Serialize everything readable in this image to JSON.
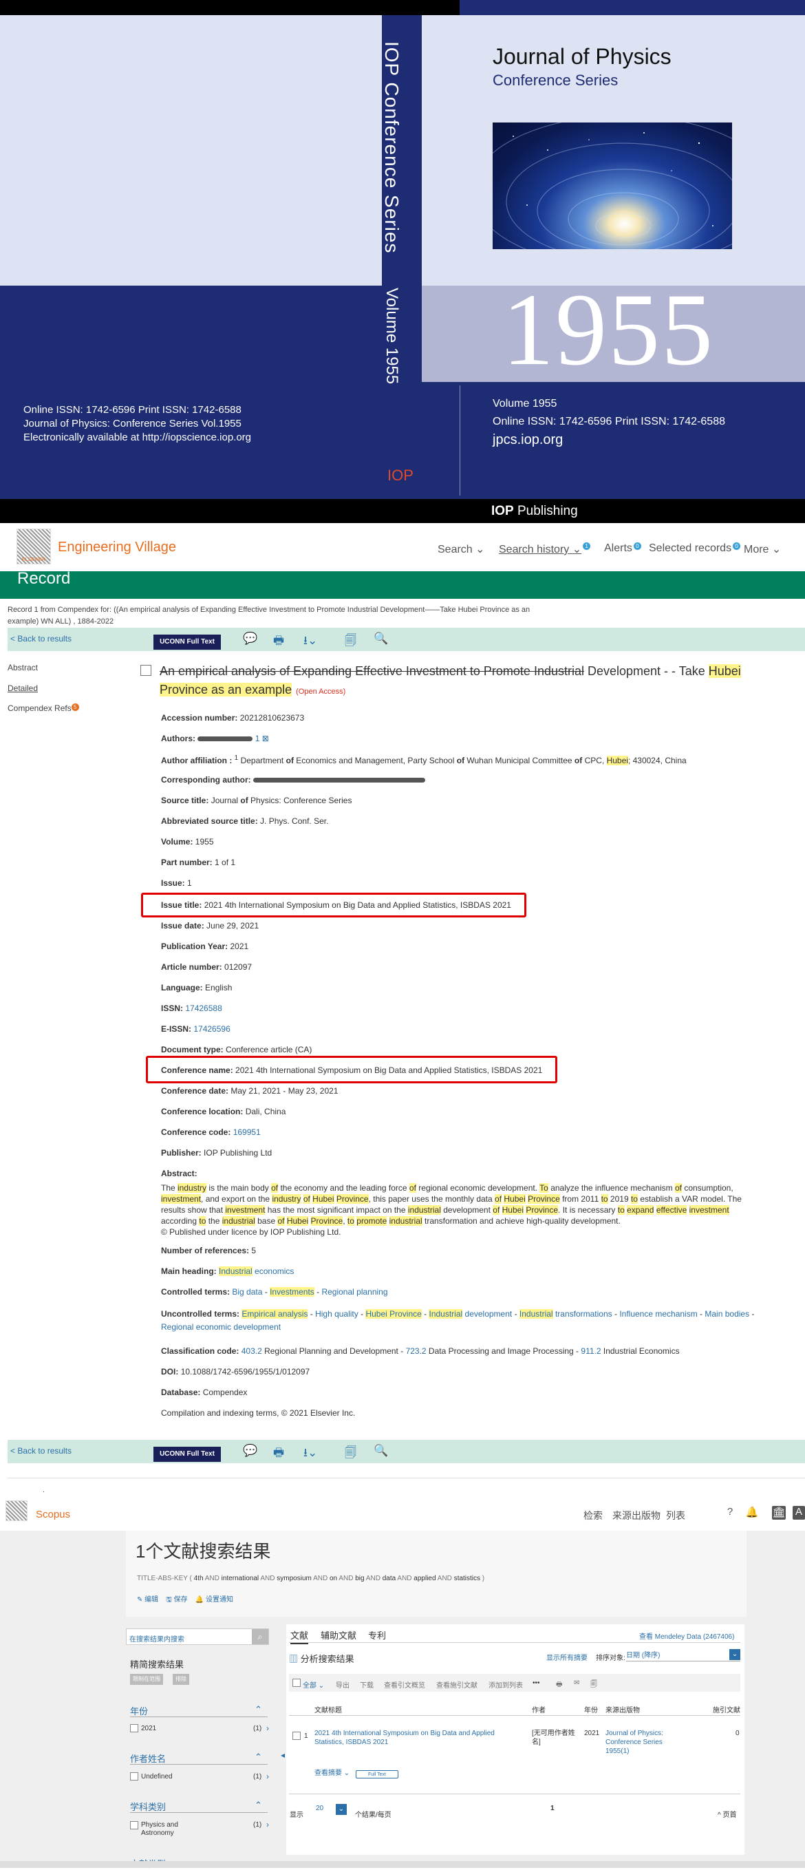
{
  "cover": {
    "spine_title": "IOP Conference Series",
    "spine_volume": "Volume 1955",
    "journal_title": "Journal of Physics",
    "journal_subtitle": "Conference Series",
    "big_number": "1955",
    "right_volume": "Volume 1955",
    "right_issn": "Online ISSN: 1742-6596   Print ISSN: 1742-6588",
    "right_url": "jpcs.iop.org",
    "left_issn": "Online ISSN: 1742-6596   Print ISSN: 1742-6588",
    "left_series": "Journal of Physics: Conference Series  Vol.1955",
    "left_avail": "Electronically available at http://iopscience.iop.org",
    "spine_logo": "IOP",
    "publisher_bold": "IOP",
    "publisher_rest": " Publishing"
  },
  "ev": {
    "logo_text": "ELSEVIER",
    "brand": "Engineering Village",
    "nav": [
      {
        "label": "Search",
        "caret": "⌄"
      },
      {
        "label": "Search history",
        "caret": "⌄",
        "badge": "1"
      },
      {
        "label": "Alerts",
        "badge": "0"
      },
      {
        "label": "Selected records",
        "badge": "0"
      },
      {
        "label": "More",
        "caret": "⌄"
      }
    ],
    "record_heading": "Record",
    "crumb": "Record 1 from Compendex for: ((An empirical analysis of Expanding Effective Investment to Promote Industrial Development——Take Hubei Province as an example) WN ALL) , 1884-2022",
    "back": "< Back to results",
    "uconn": "UCONN Full Text",
    "toolbar_icons": [
      "💬",
      "🖶",
      "⭳⌄",
      "🗐",
      "🔍"
    ],
    "side": [
      {
        "label": "Abstract"
      },
      {
        "label": "Detailed"
      },
      {
        "label": "Compendex Refs",
        "badge": "5"
      }
    ],
    "title_strike": "An empirical analysis of Expanding Effective Investment to Promote Industrial",
    "title_plain": " Development - - Take ",
    "title_hl1": "Hubei",
    "title_hl2": "Province as an example",
    "open_access": "(Open Access)",
    "fields": {
      "accession_label": "Accession number:",
      "accession": "20212810623673",
      "authors_label": "Authors:",
      "authors_tail": "1 ⊠",
      "affil_label": "Author affiliation :",
      "affil_sup": "1",
      "affil_a": " Department ",
      "affil_of1": "of",
      "affil_b": " Economics and Management, Party School ",
      "affil_of2": "of",
      "affil_c": " Wuhan Municipal Committee ",
      "affil_of3": "of",
      "affil_d": " CPC, ",
      "affil_hubei": "Hubei",
      "affil_e": "; 430024, China",
      "corr_label": "Corresponding author:",
      "source_label": "Source title:",
      "source_a": " Journal ",
      "source_of": "of",
      "source_b": " Physics: Conference Series",
      "abbrev_label": "Abbreviated source title:",
      "abbrev": "J. Phys. Conf. Ser.",
      "volume_label": "Volume:",
      "volume": "1955",
      "part_label": "Part number:",
      "part": "1 of 1",
      "issue_label": "Issue:",
      "issue": "1",
      "issue_title_label": "Issue title:",
      "issue_title": "2021 4th International Symposium on Big Data and Applied Statistics, ISBDAS 2021",
      "issue_date_label": "Issue date:",
      "issue_date": "June 29, 2021",
      "pubyear_label": "Publication Year:",
      "pubyear": "2021",
      "article_label": "Article number:",
      "article": "012097",
      "language_label": "Language:",
      "language": "English",
      "issn_label": "ISSN:",
      "issn": "17426588",
      "eissn_label": "E-ISSN:",
      "eissn": "17426596",
      "doctype_label": "Document type:",
      "doctype": "Conference article (CA)",
      "confname_label": "Conference name:",
      "confname": "2021 4th International Symposium on Big Data and Applied Statistics, ISBDAS 2021",
      "confdate_label": "Conference date:",
      "confdate": "May 21, 2021 - May 23, 2021",
      "confloc_label": "Conference location:",
      "confloc": "Dali, China",
      "confcode_label": "Conference code:",
      "confcode": "169951",
      "publisher_label": "Publisher:",
      "publisher": "IOP Publishing Ltd",
      "abstract_label": "Abstract:",
      "abstract_parts": [
        {
          "t": "The "
        },
        {
          "t": "industry",
          "h": true
        },
        {
          "t": " is the main body "
        },
        {
          "t": "of",
          "h": true
        },
        {
          "t": " the economy and the leading force "
        },
        {
          "t": "of",
          "h": true
        },
        {
          "t": " regional economic development. "
        },
        {
          "t": "To",
          "h": true
        },
        {
          "t": " analyze the influence mechanism "
        },
        {
          "t": "of",
          "h": true
        },
        {
          "t": " consumption, "
        },
        {
          "t": "investment",
          "h": true
        },
        {
          "t": ", and export on the "
        },
        {
          "t": "industry",
          "h": true
        },
        {
          "t": " "
        },
        {
          "t": "of",
          "h": true
        },
        {
          "t": " "
        },
        {
          "t": "Hubei",
          "h": true
        },
        {
          "t": " "
        },
        {
          "t": "Province",
          "h": true
        },
        {
          "t": ", this paper uses the monthly data "
        },
        {
          "t": "of",
          "h": true
        },
        {
          "t": " "
        },
        {
          "t": "Hubei",
          "h": true
        },
        {
          "t": " "
        },
        {
          "t": "Province",
          "h": true
        },
        {
          "t": " from 2011 "
        },
        {
          "t": "to",
          "h": true
        },
        {
          "t": " 2019 "
        },
        {
          "t": "to",
          "h": true
        },
        {
          "t": " establish a VAR model. The results show that "
        },
        {
          "t": "investment",
          "h": true
        },
        {
          "t": " has the most significant impact on the "
        },
        {
          "t": "industrial",
          "h": true
        },
        {
          "t": " development "
        },
        {
          "t": "of",
          "h": true
        },
        {
          "t": " "
        },
        {
          "t": "Hubei",
          "h": true
        },
        {
          "t": " "
        },
        {
          "t": "Province",
          "h": true
        },
        {
          "t": ". It is necessary "
        },
        {
          "t": "to",
          "h": true
        },
        {
          "t": " "
        },
        {
          "t": "expand",
          "h": true
        },
        {
          "t": " "
        },
        {
          "t": "effective",
          "h": true
        },
        {
          "t": " "
        },
        {
          "t": "investment",
          "h": true
        },
        {
          "t": " according "
        },
        {
          "t": "to",
          "h": true
        },
        {
          "t": " the "
        },
        {
          "t": "industrial",
          "h": true
        },
        {
          "t": " base "
        },
        {
          "t": "of",
          "h": true
        },
        {
          "t": " "
        },
        {
          "t": "Hubei",
          "h": true
        },
        {
          "t": " "
        },
        {
          "t": "Province",
          "h": true
        },
        {
          "t": ", "
        },
        {
          "t": "to",
          "h": true
        },
        {
          "t": " "
        },
        {
          "t": "promote",
          "h": true
        },
        {
          "t": " "
        },
        {
          "t": "industrial",
          "h": true
        },
        {
          "t": " transformation and achieve high-quality development."
        }
      ],
      "license": "© Published under licence by IOP Publishing Ltd.",
      "refs_label": "Number of references:",
      "refs": "5",
      "mainhead_label": "Main heading:",
      "mainhead_hl": "Industrial",
      "mainhead_rest": " economics",
      "controlled_label": "Controlled terms:",
      "controlled": [
        {
          "t": "Big data"
        },
        {
          "t": "Investments",
          "h": true
        },
        {
          "t": "Regional planning"
        }
      ],
      "uncontrolled_label": "Uncontrolled terms:",
      "uncontrolled": [
        [
          {
            "t": "Empirical analysis",
            "h": true
          }
        ],
        [
          {
            "t": "High quality"
          }
        ],
        [
          {
            "t": "Hubei Province",
            "h": true
          }
        ],
        [
          {
            "t": "Industrial",
            "h": true
          },
          {
            "t": " development"
          }
        ],
        [
          {
            "t": "Industrial",
            "h": true
          },
          {
            "t": " transformations"
          }
        ],
        [
          {
            "t": "Influence mechanism"
          }
        ],
        [
          {
            "t": "Main bodies"
          }
        ],
        [
          {
            "t": "Regional economic development"
          }
        ]
      ],
      "class_label": "Classification code:",
      "class": [
        {
          "code": "403.2",
          "desc": "Regional Planning and Development"
        },
        {
          "code": "723.2",
          "desc": "Data Processing and Image Processing"
        },
        {
          "code": "911.2",
          "desc": "Industrial Economics"
        }
      ],
      "doi_label": "DOI:",
      "doi": "10.1088/1742-6596/1955/1/012097",
      "db_label": "Database:",
      "db": "Compendex",
      "copyright": "Compilation and indexing terms, © 2021 Elsevier Inc."
    }
  },
  "scopus": {
    "dot": ".",
    "brand": "Scopus",
    "nav": [
      "检索",
      "来源出版物",
      "列表"
    ],
    "icons": [
      "?",
      "🔔",
      "🏛",
      "A"
    ],
    "results_heading": "1个文献搜索结果",
    "query_parts": [
      {
        "t": "TITLE-ABS-KEY ( "
      },
      {
        "t": "4th",
        "b": true
      },
      {
        "t": " AND "
      },
      {
        "t": "international",
        "b": true
      },
      {
        "t": " AND "
      },
      {
        "t": "symposium",
        "b": true
      },
      {
        "t": " AND "
      },
      {
        "t": "on",
        "b": true
      },
      {
        "t": " AND "
      },
      {
        "t": "big",
        "b": true
      },
      {
        "t": " AND "
      },
      {
        "t": "data",
        "b": true
      },
      {
        "t": " AND "
      },
      {
        "t": "applied",
        "b": true
      },
      {
        "t": " AND "
      },
      {
        "t": "statistics",
        "b": true
      },
      {
        "t": " )"
      }
    ],
    "actions": [
      "✎ 编辑",
      "🖫 保存",
      "🔔 设置通知"
    ],
    "search_within": "在搜索结果内搜索",
    "refine": "精简搜索结果",
    "pill1": "限制在范围",
    "pill2": "排除",
    "facets": [
      {
        "name": "年份",
        "items": [
          {
            "label": "2021",
            "count": "(1)"
          }
        ]
      },
      {
        "name": "作者姓名",
        "items": [
          {
            "label": "Undefined",
            "count": "(1)"
          }
        ]
      },
      {
        "name": "学科类别",
        "items": [
          {
            "label": "Physics and Astronomy",
            "count": "(1)"
          }
        ]
      }
    ],
    "last_facet": "文献类型",
    "tabs": [
      "文献",
      "辅助文献",
      "专利"
    ],
    "mendeley": "查看 Mendeley Data (2467406)",
    "analyze": "分析搜索结果",
    "show_abs": "显示所有摘要",
    "sort_label": "排序对象:",
    "sort_value": "日期 (降序)",
    "toolbar": [
      "全部 ⌄",
      "导出",
      "下载",
      "查看引文概览",
      "查看施引文献",
      "添加到列表",
      "•••",
      "🖶",
      "✉",
      "🗐"
    ],
    "headers": [
      "文献标题",
      "作者",
      "年份",
      "来源出版物",
      "施引文献"
    ],
    "row": {
      "num": "1",
      "title": "2021 4th International Symposium on Big Data and Applied Statistics, ISBDAS 2021",
      "author": "[无可用作者姓名]",
      "year": "2021",
      "source": "Journal of Physics: Conference Series 1955(1)",
      "cited": "0",
      "abstract_link": "查看摘要 ⌄",
      "fulltext": "Full Text"
    },
    "footer_show": "显示",
    "footer_count": "20",
    "footer_per": "个结果/每页",
    "footer_page": "1",
    "footer_top": "^ 页首"
  }
}
